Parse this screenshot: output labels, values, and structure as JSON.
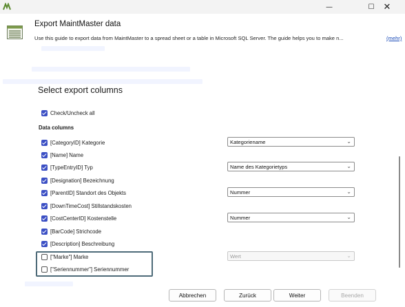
{
  "window": {
    "title_icon": "maintmaster-logo-icon",
    "minimize_glyph": "—",
    "maximize_glyph": "☐",
    "close_glyph": "✕"
  },
  "header": {
    "icon": "spreadsheet-icon",
    "title": "Export MaintMaster data",
    "description": "Use this guide to export data from MaintMaster to a spread sheet or a table in Microsoft SQL Server. The guide helps you to make n...",
    "more_link": "(mehr)"
  },
  "section": {
    "title": "Select export columns",
    "check_all_label": "Check/Uncheck all",
    "check_all_checked": true,
    "group_label": "Data columns"
  },
  "columns": [
    {
      "label": "[CategoryID] Kategorie",
      "checked": true,
      "select": "Kategoriename"
    },
    {
      "label": "[Name] Name",
      "checked": true,
      "select": ""
    },
    {
      "label": "[TypeEntryID] Typ",
      "checked": true,
      "select": "Name des Kategorietyps"
    },
    {
      "label": "[Designation] Bezeichnung",
      "checked": true,
      "select": ""
    },
    {
      "label": "[ParentID] Standort des Objekts",
      "checked": true,
      "select": "Nummer"
    },
    {
      "label": "[DownTimeCost] Stillstandskosten",
      "checked": true,
      "select": ""
    },
    {
      "label": "[CostCenterID] Kostenstelle",
      "checked": true,
      "select": "Nummer"
    },
    {
      "label": "[BarCode] Strichcode",
      "checked": true,
      "select": ""
    },
    {
      "label": "[Description] Beschreibung",
      "checked": true,
      "select": ""
    },
    {
      "label": "[\"Marke\"] Marke",
      "checked": false,
      "select": "Wert",
      "select_disabled": true
    },
    {
      "label": "[\"Seriennummer\"] Seriennummer",
      "checked": false,
      "select": ""
    }
  ],
  "chevron_glyph": "⌄",
  "footer": {
    "cancel": "Abbrechen",
    "back": "Zurück",
    "next": "Weiter",
    "finish": "Beenden"
  },
  "colors": {
    "checkbox_accent": "#3b4fc4",
    "highlight_border": "#4d6a78",
    "link": "#1a4bb8"
  }
}
